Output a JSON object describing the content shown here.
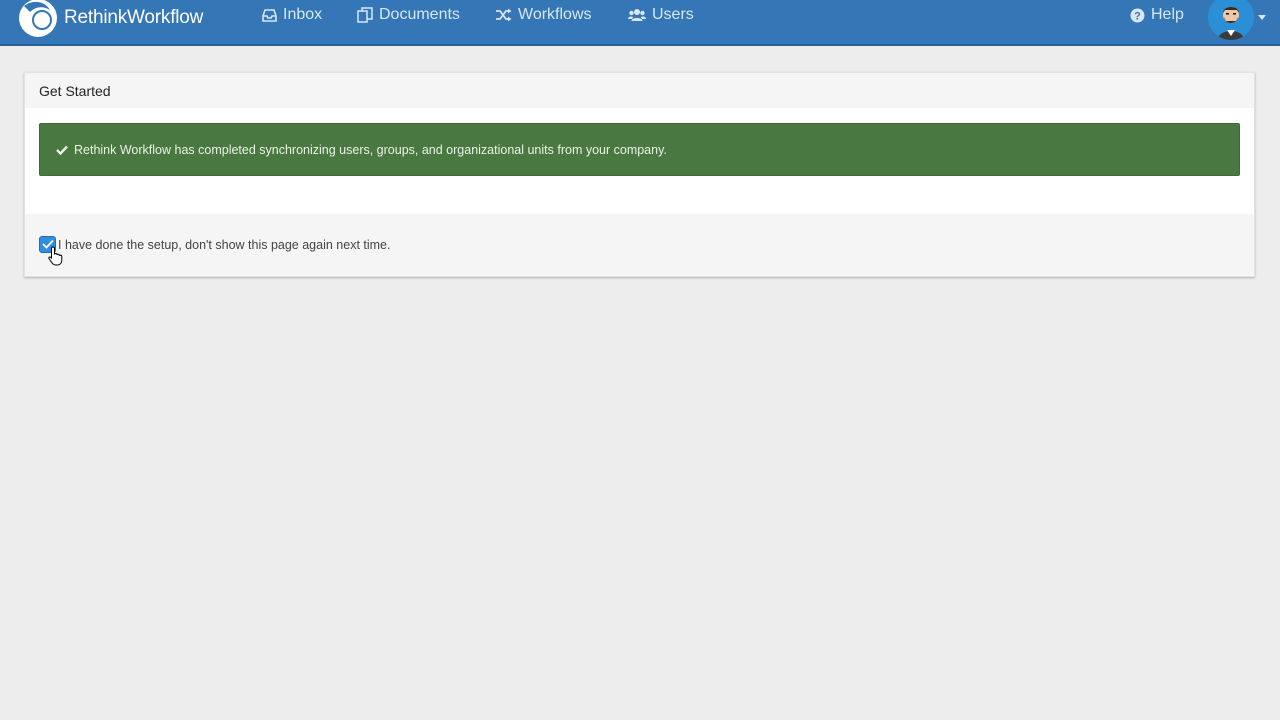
{
  "navbar": {
    "brand": "RethinkWorkflow",
    "items": [
      {
        "label": "Inbox",
        "icon": "inbox-icon"
      },
      {
        "label": "Documents",
        "icon": "documents-icon"
      },
      {
        "label": "Workflows",
        "icon": "shuffle-icon"
      },
      {
        "label": "Users",
        "icon": "users-icon"
      }
    ],
    "help": {
      "label": "Help",
      "icon": "question-circle-icon"
    },
    "avatar_icon": "user-avatar-icon"
  },
  "panel": {
    "title": "Get Started",
    "alert": {
      "icon": "check-icon",
      "text": "Rethink Workflow has completed synchronizing users, groups, and organizational units from your company."
    },
    "checkbox": {
      "label": "I have done the setup, don't show this page again next time.",
      "checked": true
    }
  },
  "colors": {
    "navbar": "#3476b6",
    "alert_bg": "#4a7841",
    "checkbox": "#2f8fdd",
    "page_bg": "#ededed"
  }
}
